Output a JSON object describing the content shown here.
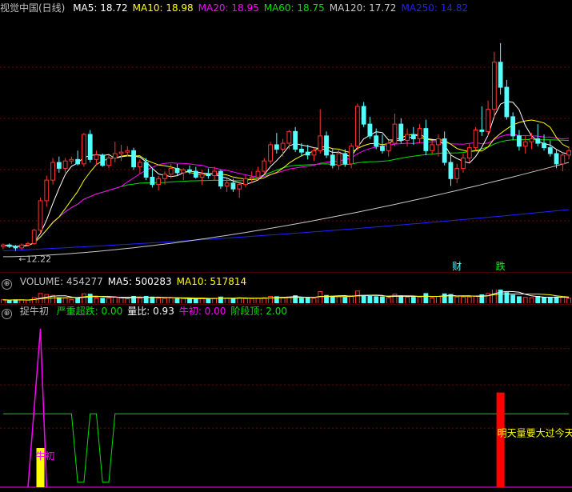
{
  "colors": {
    "bg": "#000000",
    "grid": "#7a0000",
    "up": "#ff3232",
    "down": "#54ffff",
    "ma5": "#ffffff",
    "ma10": "#ffff00",
    "ma20": "#ff00ff",
    "ma60": "#00e000",
    "ma120": "#c8c8c8",
    "ma250": "#2020ff"
  },
  "price_panel": {
    "title": "视觉中国(日线)",
    "indicators": [
      {
        "label": "MA5: 18.72",
        "color": "#ffffff"
      },
      {
        "label": "MA10: 18.98",
        "color": "#ffff00"
      },
      {
        "label": "MA20: 18.95",
        "color": "#ff00ff"
      },
      {
        "label": "MA60: 18.75",
        "color": "#00e000"
      },
      {
        "label": "MA120: 17.72",
        "color": "#c8c8c8"
      },
      {
        "label": "MA250: 14.82",
        "color": "#2020ff"
      }
    ],
    "low_label": "12.22",
    "events": [
      {
        "label": "财",
        "index": 73
      },
      {
        "label": "跌",
        "index": 80
      }
    ]
  },
  "volume_panel": {
    "labels": [
      {
        "label": "VOLUME: 454277",
        "color": "#c0c0c0"
      },
      {
        "label": "MA5: 500283",
        "color": "#ffffff"
      },
      {
        "label": "MA10: 517814",
        "color": "#ffff00"
      }
    ]
  },
  "indicator_panel": {
    "title": "捉牛初",
    "labels": [
      {
        "label": "严重超跌: 0.00",
        "color": "#00e000"
      },
      {
        "label": "量比: 0.93",
        "color": "#ffffff"
      },
      {
        "label": "牛初: 0.00",
        "color": "#ff00ff"
      },
      {
        "label": "阶段顶: 2.00",
        "color": "#00e000"
      }
    ],
    "annotations": {
      "niuchu": "牛初",
      "volume_note": "明天量要大过今天"
    }
  },
  "chart_data": {
    "type": "candlestick",
    "ylim": [
      11.0,
      27.5
    ],
    "candles": [
      [
        12.3,
        12.5,
        12.1,
        12.4
      ],
      [
        12.4,
        12.5,
        12.2,
        12.3
      ],
      [
        12.3,
        12.4,
        12.0,
        12.2
      ],
      [
        12.2,
        12.5,
        12.1,
        12.4
      ],
      [
        12.4,
        12.6,
        12.3,
        12.5
      ],
      [
        12.5,
        13.5,
        12.4,
        13.4
      ],
      [
        13.4,
        15.6,
        13.2,
        15.4
      ],
      [
        15.4,
        17.1,
        15.0,
        16.8
      ],
      [
        16.8,
        18.3,
        16.5,
        18.0
      ],
      [
        18.0,
        18.4,
        17.3,
        17.6
      ],
      [
        17.6,
        18.3,
        17.3,
        18.1
      ],
      [
        18.1,
        18.4,
        17.9,
        18.2
      ],
      [
        18.2,
        18.8,
        17.8,
        17.9
      ],
      [
        17.9,
        20.0,
        17.7,
        19.9
      ],
      [
        19.9,
        20.2,
        18.0,
        18.2
      ],
      [
        18.2,
        18.8,
        17.8,
        18.5
      ],
      [
        18.5,
        18.6,
        17.7,
        17.8
      ],
      [
        17.8,
        18.5,
        17.6,
        18.3
      ],
      [
        18.3,
        19.4,
        18.0,
        18.6
      ],
      [
        18.6,
        19.2,
        18.1,
        18.7
      ],
      [
        18.7,
        19.1,
        18.4,
        18.8
      ],
      [
        18.8,
        19.0,
        17.5,
        17.7
      ],
      [
        17.7,
        18.2,
        17.2,
        18.0
      ],
      [
        18.0,
        18.3,
        16.8,
        17.0
      ],
      [
        17.0,
        17.6,
        16.3,
        16.5
      ],
      [
        16.5,
        17.1,
        16.1,
        16.9
      ],
      [
        16.9,
        17.4,
        16.5,
        17.2
      ],
      [
        17.2,
        17.9,
        16.9,
        17.6
      ],
      [
        17.6,
        17.9,
        17.1,
        17.3
      ],
      [
        17.3,
        17.6,
        16.8,
        17.5
      ],
      [
        17.5,
        17.8,
        17.2,
        17.4
      ],
      [
        17.4,
        17.7,
        16.9,
        17.0
      ],
      [
        17.0,
        17.5,
        16.5,
        17.2
      ],
      [
        17.2,
        17.6,
        16.9,
        17.1
      ],
      [
        17.1,
        17.7,
        16.8,
        17.4
      ],
      [
        17.4,
        17.5,
        16.2,
        16.4
      ],
      [
        16.4,
        16.9,
        16.0,
        16.6
      ],
      [
        16.6,
        16.9,
        16.0,
        16.2
      ],
      [
        16.2,
        16.7,
        15.6,
        16.5
      ],
      [
        16.5,
        17.1,
        16.3,
        16.9
      ],
      [
        16.9,
        17.4,
        16.6,
        17.0
      ],
      [
        17.0,
        17.7,
        16.8,
        17.4
      ],
      [
        17.4,
        18.3,
        17.2,
        18.1
      ],
      [
        18.1,
        19.4,
        17.9,
        19.2
      ],
      [
        19.2,
        20.0,
        18.6,
        18.9
      ],
      [
        18.9,
        19.6,
        18.4,
        19.3
      ],
      [
        19.3,
        20.2,
        18.9,
        20.1
      ],
      [
        20.1,
        20.4,
        18.7,
        18.9
      ],
      [
        18.9,
        19.3,
        18.4,
        18.7
      ],
      [
        18.7,
        19.2,
        18.2,
        18.5
      ],
      [
        18.5,
        19.0,
        18.1,
        18.8
      ],
      [
        18.8,
        21.6,
        18.6,
        19.8
      ],
      [
        19.8,
        20.1,
        18.3,
        18.5
      ],
      [
        18.5,
        18.9,
        17.6,
        17.8
      ],
      [
        17.8,
        18.9,
        17.5,
        18.6
      ],
      [
        18.6,
        18.9,
        17.7,
        17.9
      ],
      [
        17.9,
        19.3,
        17.6,
        19.1
      ],
      [
        19.1,
        22.0,
        18.8,
        21.8
      ],
      [
        21.8,
        22.1,
        20.4,
        20.6
      ],
      [
        20.6,
        21.1,
        19.6,
        19.8
      ],
      [
        19.8,
        20.3,
        18.9,
        19.1
      ],
      [
        19.1,
        19.9,
        18.6,
        18.8
      ],
      [
        18.8,
        19.5,
        18.4,
        19.3
      ],
      [
        19.3,
        21.3,
        19.1,
        20.6
      ],
      [
        20.6,
        21.0,
        19.3,
        19.5
      ],
      [
        19.5,
        20.3,
        19.1,
        19.9
      ],
      [
        19.9,
        20.4,
        19.2,
        19.6
      ],
      [
        19.6,
        20.6,
        19.3,
        20.3
      ],
      [
        20.3,
        20.9,
        18.5,
        18.8
      ],
      [
        18.8,
        19.5,
        18.5,
        19.2
      ],
      [
        19.2,
        19.9,
        18.4,
        19.6
      ],
      [
        19.6,
        20.1,
        17.8,
        18.0
      ],
      [
        18.0,
        18.5,
        16.4,
        16.9
      ],
      [
        16.9,
        17.9,
        16.6,
        17.6
      ],
      [
        17.6,
        18.6,
        17.3,
        18.3
      ],
      [
        18.3,
        19.3,
        18.0,
        19.0
      ],
      [
        19.0,
        20.4,
        18.8,
        20.2
      ],
      [
        20.2,
        21.8,
        19.8,
        20.1
      ],
      [
        20.1,
        22.2,
        19.8,
        21.6
      ],
      [
        21.6,
        25.5,
        21.0,
        24.8
      ],
      [
        24.8,
        26.1,
        22.6,
        23.1
      ],
      [
        23.1,
        23.6,
        20.9,
        21.1
      ],
      [
        21.1,
        21.4,
        19.5,
        19.8
      ],
      [
        19.8,
        20.2,
        18.8,
        19.1
      ],
      [
        19.1,
        19.8,
        18.6,
        19.4
      ],
      [
        19.4,
        20.0,
        18.9,
        19.6
      ],
      [
        19.6,
        20.6,
        19.1,
        19.3
      ],
      [
        19.3,
        19.9,
        18.8,
        19.0
      ],
      [
        19.0,
        19.5,
        18.4,
        18.6
      ],
      [
        18.6,
        18.9,
        17.6,
        17.9
      ],
      [
        17.9,
        18.7,
        17.4,
        18.5
      ],
      [
        18.5,
        19.1,
        18.2,
        18.8
      ]
    ],
    "volume_scale": [
      0,
      1000000
    ],
    "indicator_scale": [
      0,
      10
    ]
  }
}
